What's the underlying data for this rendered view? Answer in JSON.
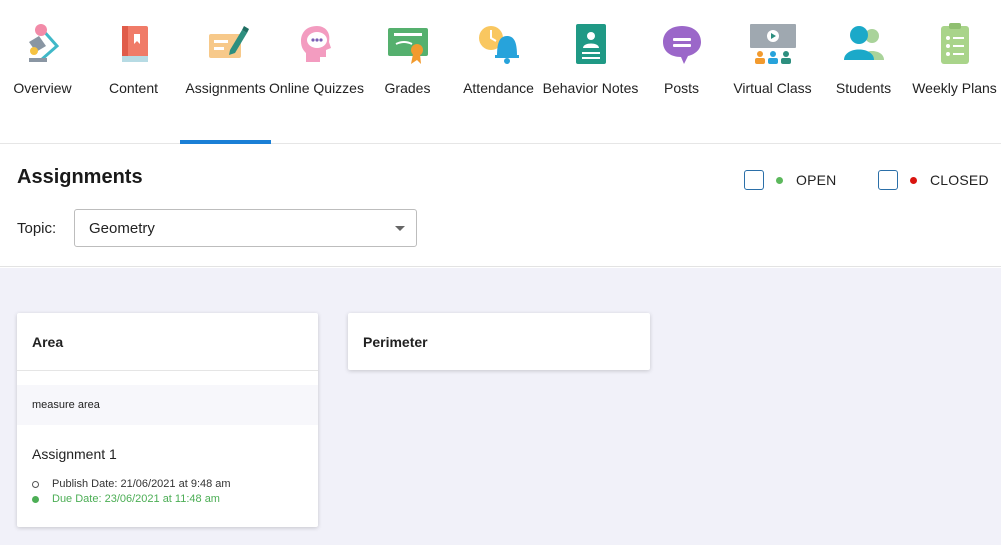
{
  "nav": {
    "items": [
      {
        "label": "Overview",
        "icon": "overview-icon"
      },
      {
        "label": "Content",
        "icon": "book-icon"
      },
      {
        "label": "Assignments",
        "icon": "assignment-pen-icon"
      },
      {
        "label": "Online Quizzes",
        "icon": "quiz-head-icon"
      },
      {
        "label": "Grades",
        "icon": "certificate-icon"
      },
      {
        "label": "Attendance",
        "icon": "bell-clock-icon"
      },
      {
        "label": "Behavior Notes",
        "icon": "id-card-icon"
      },
      {
        "label": "Posts",
        "icon": "chat-bubble-icon"
      },
      {
        "label": "Virtual Class",
        "icon": "virtual-class-icon"
      },
      {
        "label": "Students",
        "icon": "students-icon"
      },
      {
        "label": "Weekly Plans",
        "icon": "clipboard-list-icon"
      }
    ],
    "active_index": 2
  },
  "header": {
    "title": "Assignments",
    "legend_open": "OPEN",
    "legend_closed": "CLOSED",
    "topic_label": "Topic:",
    "topic_value": "Geometry"
  },
  "colors": {
    "open": "#5cb85c",
    "closed": "#d9140f",
    "accent": "#1a7fd6",
    "due": "#4cae55"
  },
  "cards": [
    {
      "title": "Area",
      "description": "measure area",
      "assignment": {
        "name": "Assignment 1",
        "publish": "Publish Date: 21/06/2021 at 9:48 am",
        "due": "Due Date: 23/06/2021 at 11:48 am"
      }
    },
    {
      "title": "Perimeter"
    }
  ]
}
